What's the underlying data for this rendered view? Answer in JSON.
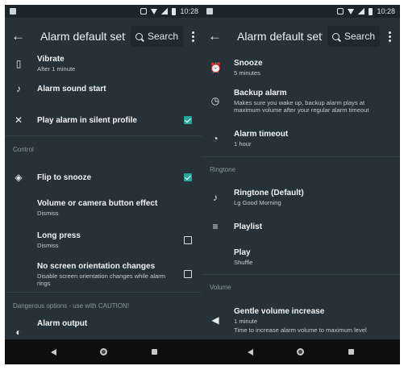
{
  "status": {
    "time": "10:28"
  },
  "left": {
    "title": "Alarm default sett…",
    "search_label": "Search",
    "items": [
      {
        "title": "Vibrate",
        "subtitle": "After 1 minute",
        "icon": "vibrate-icon"
      },
      {
        "title": "Alarm sound start",
        "subtitle": "",
        "icon": "music-note-icon"
      },
      {
        "title": "Play alarm in silent profile",
        "subtitle": "",
        "icon": "volume-mute-icon",
        "checked": true
      }
    ],
    "section_control": "Control",
    "control_items": [
      {
        "title": "Flip to snooze",
        "subtitle": "",
        "icon": "rotate-icon",
        "checked": true
      },
      {
        "title": "Volume or camera button effect",
        "subtitle": "Dismiss"
      },
      {
        "title": "Long press",
        "subtitle": "Dismiss",
        "checked": false
      },
      {
        "title": "No screen orientation changes",
        "subtitle": "Disable screen orientation changes while alarm rings",
        "checked": false
      }
    ],
    "section_danger": "Dangerous options - use with CAUTION!",
    "danger_items": [
      {
        "title": "Alarm output",
        "icon": "speaker-icon"
      }
    ]
  },
  "right": {
    "title": "Alarm default sett…",
    "search_label": "Search",
    "items": [
      {
        "title": "Snooze",
        "subtitle": "5 minutes",
        "icon": "snooze-clock-icon"
      },
      {
        "title": "Backup alarm",
        "subtitle": "Makes sure you wake up, backup alarm plays at maximum volume after your regular alarm timeout",
        "icon": "clock-icon"
      },
      {
        "title": "Alarm timeout",
        "subtitle": "1 hour",
        "icon": "timer-icon"
      }
    ],
    "section_ringtone": "Ringtone",
    "ringtone_items": [
      {
        "title": "Ringtone (Default)",
        "subtitle": "Lg Good Morning",
        "icon": "music-note-icon"
      },
      {
        "title": "Playlist",
        "subtitle": "",
        "icon": "playlist-icon"
      },
      {
        "title": "Play",
        "subtitle": "Shuffle"
      }
    ],
    "section_volume": "Volume",
    "volume_items": [
      {
        "title": "Gentle volume increase",
        "subtitle": "1 minute",
        "subtitle2": "Time to increase alarm volume to maximum level",
        "icon": "volume-up-icon"
      }
    ]
  }
}
